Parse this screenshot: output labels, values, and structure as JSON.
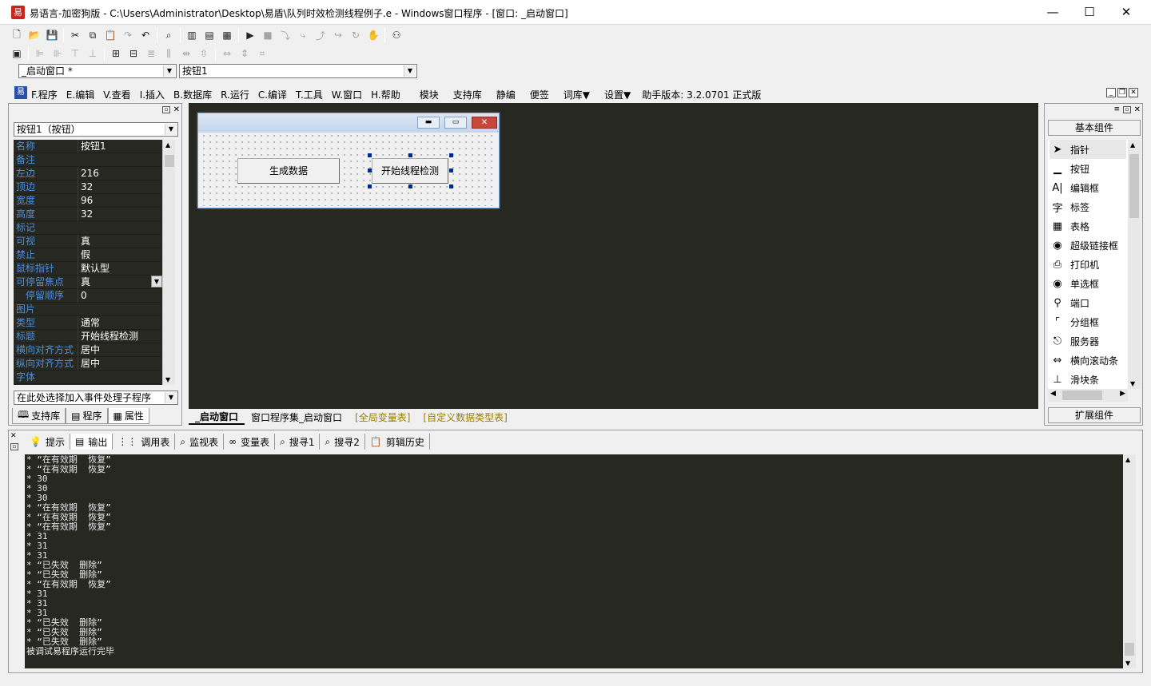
{
  "window": {
    "title": "易语言-加密狗版 - C:\\Users\\Administrator\\Desktop\\易盾\\队列时效检测线程例子.e - Windows窗口程序 - [窗口: _启动窗口]",
    "minimize": "—",
    "maximize": "☐",
    "close": "✕"
  },
  "toolbar": {
    "window_combo": "_启动窗口 *",
    "control_combo": "按钮1"
  },
  "menu": [
    "F.程序",
    "E.编辑",
    "V.查看",
    "I.插入",
    "B.数据库",
    "R.运行",
    "C.编译",
    "T.工具",
    "W.窗口",
    "H.帮助",
    "模块",
    "支持库",
    "静编",
    "便签",
    "词库▼",
    "设置▼",
    "助手版本: 3.2.0701 正式版"
  ],
  "properties": {
    "selector": "按钮1（按钮）",
    "rows": [
      {
        "name": "名称",
        "value": "按钮1"
      },
      {
        "name": "备注",
        "value": ""
      },
      {
        "name": "左边",
        "value": "216"
      },
      {
        "name": "顶边",
        "value": "32"
      },
      {
        "name": "宽度",
        "value": "96"
      },
      {
        "name": "高度",
        "value": "32"
      },
      {
        "name": "标记",
        "value": ""
      },
      {
        "name": "可视",
        "value": "真"
      },
      {
        "name": "禁止",
        "value": "假"
      },
      {
        "name": "鼠标指针",
        "value": "默认型"
      },
      {
        "name": "可停留焦点",
        "value": "真"
      },
      {
        "name": "　停留顺序",
        "value": "0"
      },
      {
        "name": "图片",
        "value": ""
      },
      {
        "name": "类型",
        "value": "通常"
      },
      {
        "name": "标题",
        "value": "开始线程检测"
      },
      {
        "name": "横向对齐方式",
        "value": "居中"
      },
      {
        "name": "纵向对齐方式",
        "value": "居中"
      },
      {
        "name": "字体",
        "value": ""
      }
    ],
    "event_combo": "在此处选择加入事件处理子程序",
    "tabs": [
      "支持库",
      "程序",
      "属性"
    ]
  },
  "design": {
    "btn_generate": "生成数据",
    "btn_start": "开始线程检测",
    "tabs": [
      "_启动窗口",
      "窗口程序集_启动窗口",
      "[全局变量表]",
      "[自定义数据类型表]"
    ]
  },
  "components": {
    "header": "基本组件",
    "items": [
      {
        "label": "指针",
        "icon": "➤"
      },
      {
        "label": "按钮",
        "icon": "▁"
      },
      {
        "label": "编辑框",
        "icon": "A|"
      },
      {
        "label": "标签",
        "icon": "字"
      },
      {
        "label": "表格",
        "icon": "▦"
      },
      {
        "label": "超级链接框",
        "icon": "◉"
      },
      {
        "label": "打印机",
        "icon": "⎙"
      },
      {
        "label": "单选框",
        "icon": "◉"
      },
      {
        "label": "端口",
        "icon": "⚲"
      },
      {
        "label": "分组框",
        "icon": "⌜"
      },
      {
        "label": "服务器",
        "icon": "⎋"
      },
      {
        "label": "横向滚动条",
        "icon": "⇔"
      },
      {
        "label": "滑块条",
        "icon": "⊥"
      }
    ],
    "footer": "扩展组件"
  },
  "output": {
    "tabs": [
      "提示",
      "输出",
      "调用表",
      "监视表",
      "变量表",
      "搜寻1",
      "搜寻2",
      "剪辑历史"
    ],
    "lines": [
      "* “在有效期  恢复”",
      "* “在有效期  恢复”",
      "* 30",
      "* 30",
      "* 30",
      "* “在有效期  恢复”",
      "* “在有效期  恢复”",
      "* “在有效期  恢复”",
      "* 31",
      "* 31",
      "* 31",
      "* “已失效  删除”",
      "* “已失效  删除”",
      "* “在有效期  恢复”",
      "* 31",
      "* 31",
      "* 31",
      "* “已失效  删除”",
      "* “已失效  删除”",
      "* “已失效  删除”",
      "被调试易程序运行完毕"
    ]
  }
}
